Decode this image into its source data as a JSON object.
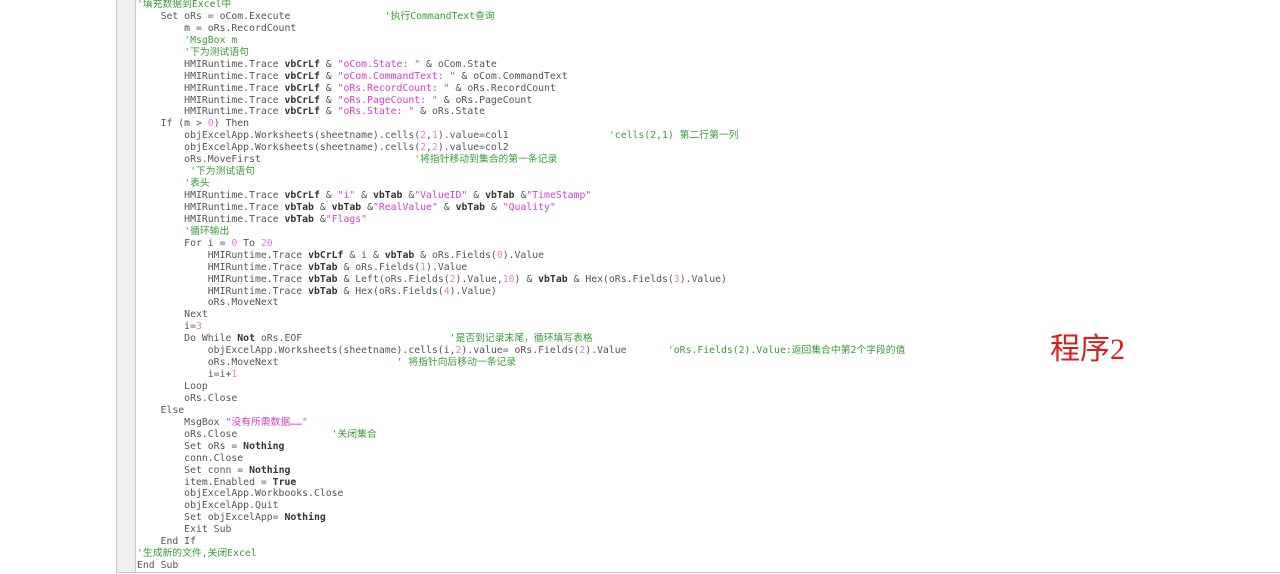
{
  "editor": {
    "lines": [
      "'填充数据到Excel中",
      "    Set oRs = oCom.Execute                '执行CommandText查询",
      "        m = oRs.RecordCount",
      "        'MsgBox m",
      "        '下为测试语句",
      "        HMIRuntime.Trace vbCrLf & \"oCom.State: \" & oCom.State",
      "        HMIRuntime.Trace vbCrLf & \"oCom.CommandText: \" & oCom.CommandText",
      "        HMIRuntime.Trace vbCrLf & \"oRs.RecordCount: \" & oRs.RecordCount",
      "        HMIRuntime.Trace vbCrLf & \"oRs.PageCount: \" & oRs.PageCount",
      "        HMIRuntime.Trace vbCrLf & \"oRs.State: \" & oRs.State",
      "    If (m > 0) Then",
      "        objExcelApp.Worksheets(sheetname).cells(2,1).value=col1                 'cells(2,1) 第二行第一列",
      "        objExcelApp.Worksheets(sheetname).cells(2,2).value=col2",
      "        oRs.MoveFirst                          '将指针移动到集合的第一条记录",
      "         '下为测试语句",
      "        '表头",
      "        HMIRuntime.Trace vbCrLf & \"i\" & vbTab &\"ValueID\" & vbTab &\"TimeStamp\"",
      "        HMIRuntime.Trace vbTab & vbTab &\"RealValue\" & vbTab & \"Quality\"",
      "        HMIRuntime.Trace vbTab &\"Flags\"",
      "        '循环输出",
      "        For i = 0 To 20",
      "            HMIRuntime.Trace vbCrLf & i & vbTab & oRs.Fields(0).Value",
      "            HMIRuntime.Trace vbTab & oRs.Fields(1).Value",
      "            HMIRuntime.Trace vbTab & Left(oRs.Fields(2).Value,10) & vbTab & Hex(oRs.Fields(3).Value)",
      "            HMIRuntime.Trace vbTab & Hex(oRs.Fields(4).Value)",
      "            oRs.MoveNext",
      "        Next",
      "        i=3",
      "        Do While Not oRs.EOF                         '是否到记录末尾，循环填写表格",
      "            objExcelApp.Worksheets(sheetname).cells(i,2).value= oRs.Fields(2).Value       'oRs.Fields(2).Value:返回集合中第2个字段的值",
      "            oRs.MoveNext                    ' 将指针向后移动一条记录",
      "            i=i+1",
      "        Loop",
      "        oRs.Close",
      "    Else",
      "        MsgBox \"没有所需数据……\"",
      "        oRs.Close                '关闭集合",
      "        Set oRs = Nothing",
      "        conn.Close",
      "        Set conn = Nothing",
      "        item.Enabled = True",
      "        objExcelApp.Workbooks.Close",
      "        objExcelApp.Quit",
      "        Set objExcelApp= Nothing",
      "        Exit Sub",
      "    End If",
      "'生成新的文件,关闭Excel",
      "End Sub"
    ],
    "bold_words": [
      "vbCrLf",
      "vbTab",
      "Nothing",
      "True",
      "Not"
    ]
  },
  "label": "程序2",
  "colors": {
    "comment": "#3a9a3a",
    "string": "#d040c8",
    "number": "#e080d8",
    "text": "#555555",
    "label": "#d42020"
  }
}
